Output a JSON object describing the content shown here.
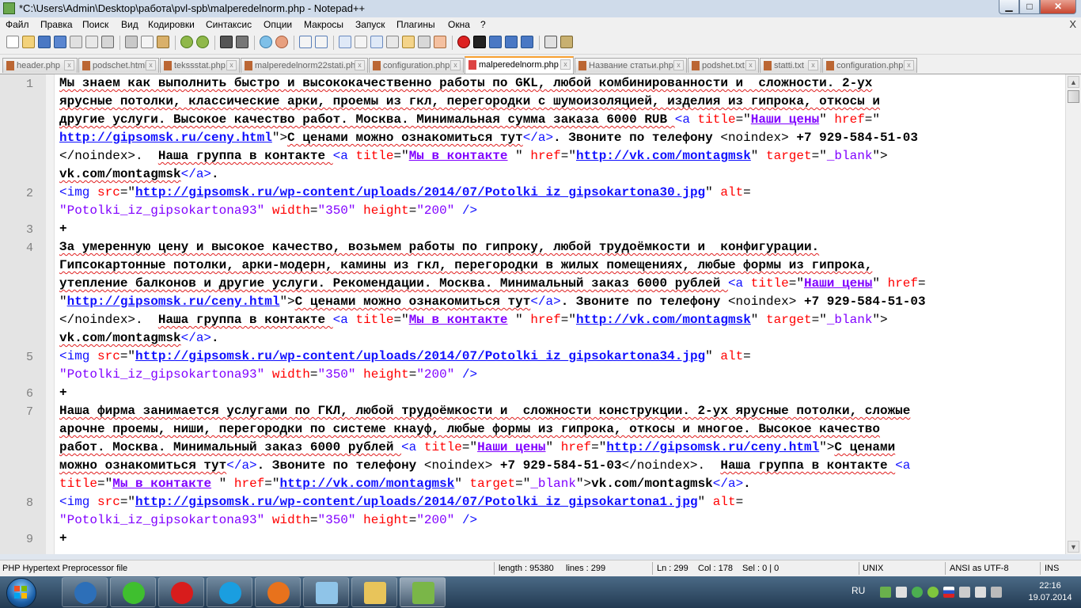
{
  "window": {
    "title": "*C:\\Users\\Admin\\Desktop\\работа\\pvl-spb\\malperedelnorm.php - Notepad++",
    "min_label": "▁",
    "max_label": "□",
    "close_label": "✕"
  },
  "menu": {
    "items": [
      "Файл",
      "Правка",
      "Поиск",
      "Вид",
      "Кодировки",
      "Синтаксис",
      "Опции",
      "Макросы",
      "Запуск",
      "Плагины",
      "Окна",
      "?"
    ],
    "close_x": "X"
  },
  "tabs": [
    {
      "label": "header.php",
      "active": false
    },
    {
      "label": "podschet.html",
      "active": false
    },
    {
      "label": "tekssstat.php",
      "active": false
    },
    {
      "label": "malperedelnorm22stati.php",
      "active": false
    },
    {
      "label": "configuration.php",
      "active": false
    },
    {
      "label": "malperedelnorm.php",
      "active": true
    },
    {
      "label": "Название статьи.php",
      "active": false
    },
    {
      "label": "podshet.txt",
      "active": false
    },
    {
      "label": "statti.txt",
      "active": false
    },
    {
      "label": "configuration.php",
      "active": false
    }
  ],
  "tab_close_glyph": "x",
  "editor": {
    "line_numbers": [
      "1",
      "2",
      "3",
      "4",
      "5",
      "6",
      "7",
      "8",
      "9"
    ],
    "rows": [
      [
        [
          "t",
          "Мы знаем как выполнить быстро и высококачественно работы по GKL, любой комбинированности и  сложности. 2-ух"
        ]
      ],
      [
        [
          "t",
          "ярусные потолки, классические арки, проемы из гкл, перегородки с шумоизоляцией, изделия из гипрока, откосы и"
        ]
      ],
      [
        [
          "t",
          "другие услуги. Высокое качество работ. Москва. Минимальная сумма заказа 6000 RUB "
        ],
        [
          "tag",
          "<a "
        ],
        [
          "attr",
          "title"
        ],
        [
          "plain",
          "=\""
        ],
        [
          "vlink",
          "Наши цены"
        ],
        [
          "plain",
          "\" "
        ],
        [
          "attr",
          "href"
        ],
        [
          "plain",
          "=\""
        ]
      ],
      [
        [
          "link",
          "http://gipsomsk.ru/ceny.html"
        ],
        [
          "plain",
          "\">"
        ],
        [
          "t",
          "С ценами можно ознакомиться тут"
        ],
        [
          "tag",
          "</a>"
        ],
        [
          "tp",
          ". Звоните по телефону "
        ],
        [
          "plain",
          "<noindex> "
        ],
        [
          "tp",
          "+7 929-584-51-03"
        ]
      ],
      [
        [
          "plain",
          "</noindex>.  "
        ],
        [
          "t",
          "Наша группа в контакте "
        ],
        [
          "tag",
          "<a "
        ],
        [
          "attr",
          "title"
        ],
        [
          "plain",
          "=\""
        ],
        [
          "vlink",
          "Мы в контакте"
        ],
        [
          "plain",
          " \" "
        ],
        [
          "attr",
          "href"
        ],
        [
          "plain",
          "=\""
        ],
        [
          "link",
          "http://vk.com/montagmsk"
        ],
        [
          "plain",
          "\" "
        ],
        [
          "attr",
          "target"
        ],
        [
          "plain",
          "=\""
        ],
        [
          "val",
          "_blank"
        ],
        [
          "plain",
          "\">"
        ]
      ],
      [
        [
          "t",
          "vk.com/montagmsk"
        ],
        [
          "tag",
          "</a>"
        ],
        [
          "tp",
          "."
        ]
      ],
      [
        [
          "tag",
          "<img "
        ],
        [
          "attr",
          "src"
        ],
        [
          "plain",
          "=\""
        ],
        [
          "link",
          "http://gipsomsk.ru/wp-content/uploads/2014/07/Potolki_iz_gipsokartona30.jpg"
        ],
        [
          "plain",
          "\" "
        ],
        [
          "attr",
          "alt"
        ],
        [
          "plain",
          "="
        ]
      ],
      [
        [
          "val",
          "\"Potolki_iz_gipsokartona93\""
        ],
        [
          "plain",
          " "
        ],
        [
          "attr",
          "width"
        ],
        [
          "plain",
          "="
        ],
        [
          "val",
          "\"350\""
        ],
        [
          "plain",
          " "
        ],
        [
          "attr",
          "height"
        ],
        [
          "plain",
          "="
        ],
        [
          "val",
          "\"200\""
        ],
        [
          "plain",
          " "
        ],
        [
          "tag",
          "/>"
        ]
      ],
      [
        [
          "tp",
          "+"
        ]
      ],
      [
        [
          "t",
          "За умеренную цену и высокое качество, возьмем работы по гипроку, любой трудоёмкости и  конфигурации."
        ]
      ],
      [
        [
          "t",
          "Гипсокартонные потолки, арки-модерн, камины из гкл, перегородки в жилых помещениях, любые формы из гипрока,"
        ]
      ],
      [
        [
          "t",
          "утепление балконов и другие услуги. Рекомендации. Москва. Минимальный заказ 6000 рублей "
        ],
        [
          "tag",
          "<a "
        ],
        [
          "attr",
          "title"
        ],
        [
          "plain",
          "=\""
        ],
        [
          "vlink",
          "Наши цены"
        ],
        [
          "plain",
          "\" "
        ],
        [
          "attr",
          "href"
        ],
        [
          "plain",
          "="
        ]
      ],
      [
        [
          "plain",
          "\""
        ],
        [
          "link",
          "http://gipsomsk.ru/ceny.html"
        ],
        [
          "plain",
          "\">"
        ],
        [
          "t",
          "С ценами можно ознакомиться тут"
        ],
        [
          "tag",
          "</a>"
        ],
        [
          "tp",
          ". Звоните по телефону "
        ],
        [
          "plain",
          "<noindex> "
        ],
        [
          "tp",
          "+7 929-584-51-03"
        ]
      ],
      [
        [
          "plain",
          "</noindex>.  "
        ],
        [
          "t",
          "Наша группа в контакте "
        ],
        [
          "tag",
          "<a "
        ],
        [
          "attr",
          "title"
        ],
        [
          "plain",
          "=\""
        ],
        [
          "vlink",
          "Мы в контакте"
        ],
        [
          "plain",
          " \" "
        ],
        [
          "attr",
          "href"
        ],
        [
          "plain",
          "=\""
        ],
        [
          "link",
          "http://vk.com/montagmsk"
        ],
        [
          "plain",
          "\" "
        ],
        [
          "attr",
          "target"
        ],
        [
          "plain",
          "=\""
        ],
        [
          "val",
          "_blank"
        ],
        [
          "plain",
          "\">"
        ]
      ],
      [
        [
          "t",
          "vk.com/montagmsk"
        ],
        [
          "tag",
          "</a>"
        ],
        [
          "tp",
          "."
        ]
      ],
      [
        [
          "tag",
          "<img "
        ],
        [
          "attr",
          "src"
        ],
        [
          "plain",
          "=\""
        ],
        [
          "link",
          "http://gipsomsk.ru/wp-content/uploads/2014/07/Potolki_iz_gipsokartona34.jpg"
        ],
        [
          "plain",
          "\" "
        ],
        [
          "attr",
          "alt"
        ],
        [
          "plain",
          "="
        ]
      ],
      [
        [
          "val",
          "\"Potolki_iz_gipsokartona93\""
        ],
        [
          "plain",
          " "
        ],
        [
          "attr",
          "width"
        ],
        [
          "plain",
          "="
        ],
        [
          "val",
          "\"350\""
        ],
        [
          "plain",
          " "
        ],
        [
          "attr",
          "height"
        ],
        [
          "plain",
          "="
        ],
        [
          "val",
          "\"200\""
        ],
        [
          "plain",
          " "
        ],
        [
          "tag",
          "/>"
        ]
      ],
      [
        [
          "tp",
          "+"
        ]
      ],
      [
        [
          "t",
          "Наша фирма занимается услугами по ГКЛ, любой трудоёмкости и  сложности конструкции. 2-ух ярусные потолки, сложые"
        ]
      ],
      [
        [
          "t",
          "арочне проемы, ниши, перегородки по системе кнауф, любые формы из гипрока, откосы и многое. Высокое качество"
        ]
      ],
      [
        [
          "t",
          "работ. Москва. Минимальный заказ 6000 рублей "
        ],
        [
          "tag",
          "<a "
        ],
        [
          "attr",
          "title"
        ],
        [
          "plain",
          "=\""
        ],
        [
          "vlink",
          "Наши цены"
        ],
        [
          "plain",
          "\" "
        ],
        [
          "attr",
          "href"
        ],
        [
          "plain",
          "=\""
        ],
        [
          "link",
          "http://gipsomsk.ru/ceny.html"
        ],
        [
          "plain",
          "\">"
        ],
        [
          "t",
          "С ценами"
        ]
      ],
      [
        [
          "t",
          "можно ознакомиться тут"
        ],
        [
          "tag",
          "</a>"
        ],
        [
          "tp",
          ". Звоните по телефону "
        ],
        [
          "plain",
          "<noindex> "
        ],
        [
          "tp",
          "+7 929-584-51-03"
        ],
        [
          "plain",
          "</noindex>.  "
        ],
        [
          "t",
          "Наша группа в контакте "
        ],
        [
          "tag",
          "<a"
        ]
      ],
      [
        [
          "attr",
          "title"
        ],
        [
          "plain",
          "=\""
        ],
        [
          "vlink",
          "Мы в контакте"
        ],
        [
          "plain",
          " \" "
        ],
        [
          "attr",
          "href"
        ],
        [
          "plain",
          "=\""
        ],
        [
          "link",
          "http://vk.com/montagmsk"
        ],
        [
          "plain",
          "\" "
        ],
        [
          "attr",
          "target"
        ],
        [
          "plain",
          "=\""
        ],
        [
          "val",
          "_blank"
        ],
        [
          "plain",
          "\">"
        ],
        [
          "tp",
          "vk.com/montagmsk"
        ],
        [
          "tag",
          "</a>"
        ],
        [
          "tp",
          "."
        ]
      ],
      [
        [
          "tag",
          "<img "
        ],
        [
          "attr",
          "src"
        ],
        [
          "plain",
          "=\""
        ],
        [
          "link",
          "http://gipsomsk.ru/wp-content/uploads/2014/07/Potolki_iz_gipsokartona1.jpg"
        ],
        [
          "plain",
          "\" "
        ],
        [
          "attr",
          "alt"
        ],
        [
          "plain",
          "="
        ]
      ],
      [
        [
          "val",
          "\"Potolki_iz_gipsokartona93\""
        ],
        [
          "plain",
          " "
        ],
        [
          "attr",
          "width"
        ],
        [
          "plain",
          "="
        ],
        [
          "val",
          "\"350\""
        ],
        [
          "plain",
          " "
        ],
        [
          "attr",
          "height"
        ],
        [
          "plain",
          "="
        ],
        [
          "val",
          "\"200\""
        ],
        [
          "plain",
          " "
        ],
        [
          "tag",
          "/>"
        ]
      ],
      [
        [
          "tp",
          "+"
        ]
      ]
    ]
  },
  "status": {
    "file_type": "PHP Hypertext Preprocessor file",
    "length": "length : 95380",
    "lines": "lines : 299",
    "ln": "Ln : 299",
    "col": "Col : 178",
    "sel": "Sel : 0 | 0",
    "eol": "UNIX",
    "encoding": "ANSI as UTF-8",
    "mode": "INS"
  },
  "taskbar": {
    "apps": [
      {
        "icon": "launcher-icon",
        "color": "#2d6fb8"
      },
      {
        "icon": "icq-icon",
        "color": "#3fbf2f"
      },
      {
        "icon": "opera-icon",
        "color": "#d81c1c"
      },
      {
        "icon": "skype-icon",
        "color": "#1a9ee0"
      },
      {
        "icon": "firefox-icon",
        "color": "#e8721c"
      },
      {
        "icon": "note-icon",
        "color": "#8fc4e8"
      },
      {
        "icon": "folder-icon",
        "color": "#e8c45a"
      },
      {
        "icon": "notepadpp-icon",
        "color": "#7ab648"
      }
    ],
    "language": "RU",
    "time": "22:16",
    "date": "19.07.2014"
  },
  "colors": {
    "html_tag": "#1010ff",
    "html_attr": "#ff0000",
    "html_value": "#8000ff",
    "line_number": "#808080",
    "active_tab_accent": "#f8a030"
  }
}
